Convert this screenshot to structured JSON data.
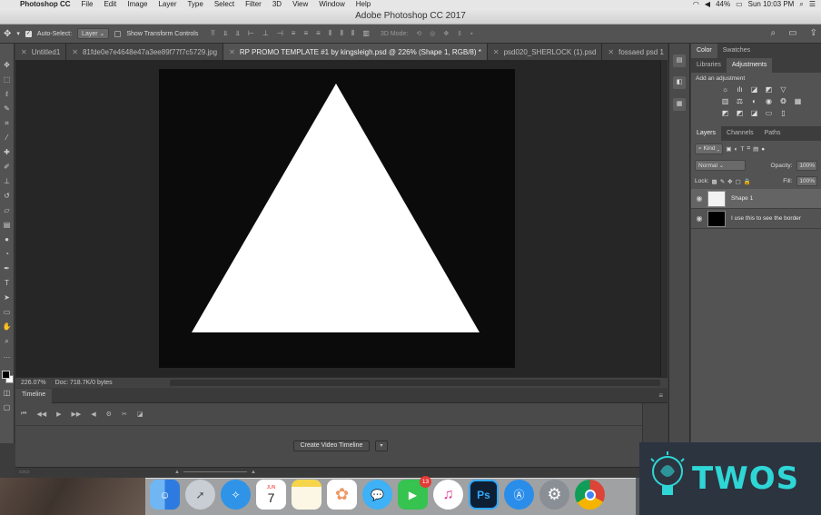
{
  "menubar": {
    "items": [
      "Photoshop CC",
      "File",
      "Edit",
      "Image",
      "Layer",
      "Type",
      "Select",
      "Filter",
      "3D",
      "View",
      "Window",
      "Help"
    ],
    "battery": "44%",
    "clock": "Sun 10:03 PM"
  },
  "window": {
    "title": "Adobe Photoshop CC 2017"
  },
  "options": {
    "auto_select_label": "Auto-Select:",
    "auto_select_value": "Layer",
    "transform_controls_label": "Show Transform Controls",
    "mode_3d_label": "3D Mode:"
  },
  "tabs": [
    {
      "label": "Untitled1"
    },
    {
      "label": "81fde0e7e4648e47a3ee89f77f7c5729.jpg"
    },
    {
      "label": "RP PROMO TEMPLATE #1 by kingsleigh.psd @ 226% (Shape 1, RGB/8) *"
    },
    {
      "label": "psd020_SHERLOCK (1).psd"
    },
    {
      "label": "fossaed psd 1"
    }
  ],
  "canvas": {
    "background_color": "#0b0b0b",
    "shape_color": "#ffffff",
    "shape": "triangle"
  },
  "status": {
    "zoom": "226.07%",
    "doc": "Doc: 718.7K/0 bytes"
  },
  "timeline": {
    "tab_label": "Timeline",
    "create_button": "Create Video Timeline"
  },
  "panels": {
    "color_tab": "Color",
    "swatches_tab": "Swatches",
    "libraries_tab": "Libraries",
    "adjustments_tab": "Adjustments",
    "adjustments_title": "Add an adjustment",
    "layers_tab": "Layers",
    "channels_tab": "Channels",
    "paths_tab": "Paths",
    "kind_label": "Kind",
    "blend_mode": "Normal",
    "opacity_label": "Opacity:",
    "opacity_value": "100%",
    "lock_label": "Lock:",
    "fill_label": "Fill:",
    "fill_value": "100%",
    "layers": [
      {
        "name": "Shape 1",
        "selected": true
      },
      {
        "name": "I use this to see the border",
        "selected": false
      }
    ]
  },
  "dock": {
    "calendar_month": "JUN",
    "calendar_day": "7",
    "facetime_badge": "13",
    "ps_label": "Ps"
  },
  "watermark": {
    "text": "TWOS"
  }
}
